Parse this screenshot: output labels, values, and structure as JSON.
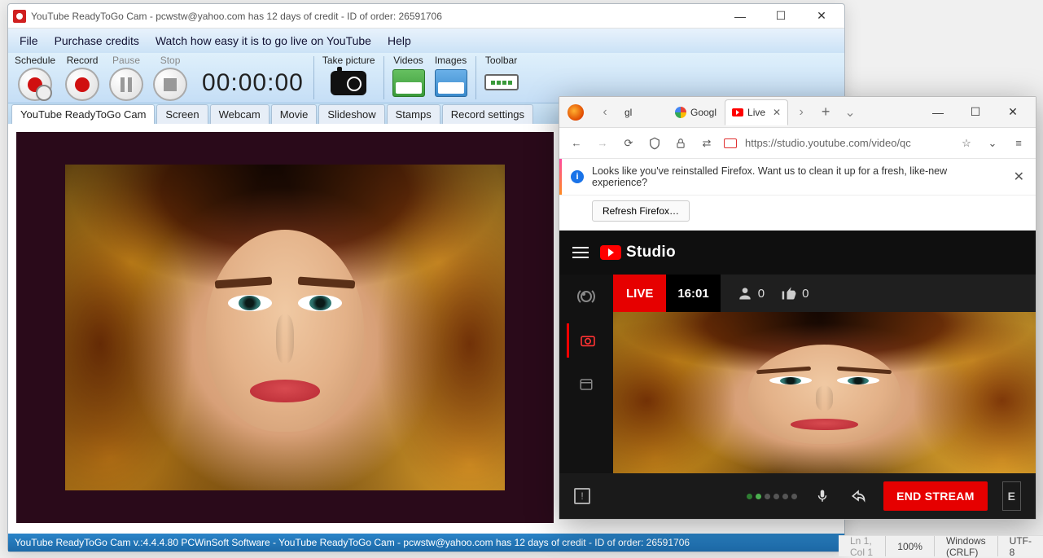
{
  "app": {
    "title": "YouTube ReadyToGo Cam - pcwstw@yahoo.com has 12 days of credit - ID of order: 26591706",
    "menu": [
      "File",
      "Purchase credits",
      "Watch how easy it is to go live on YouTube",
      "Help"
    ],
    "toolbar": {
      "schedule": "Schedule",
      "record": "Record",
      "pause": "Pause",
      "stop": "Stop",
      "timer": "00:00:00",
      "take_picture": "Take picture",
      "videos": "Videos",
      "images": "Images",
      "toolbar_label": "Toolbar"
    },
    "tabs": [
      "YouTube ReadyToGo Cam",
      "Screen",
      "Webcam",
      "Movie",
      "Slideshow",
      "Stamps",
      "Record settings"
    ],
    "active_tab_index": 0,
    "status": "YouTube ReadyToGo Cam v.:4.4.4.80 PCWinSoft Software - YouTube ReadyToGo Cam - pcwstw@yahoo.com has 12 days of credit - ID of order: 26591706"
  },
  "browser": {
    "tabs": [
      {
        "label": "gl"
      },
      {
        "label": "Googl"
      },
      {
        "label": "Live",
        "active": true
      }
    ],
    "url": "https://studio.youtube.com/video/qc",
    "info_text": "Looks like you've reinstalled Firefox. Want us to clean it up for a fresh, like-new experience?",
    "refresh_label": "Refresh Firefox…"
  },
  "studio": {
    "brand": "Studio",
    "live_badge": "LIVE",
    "elapsed": "16:01",
    "viewers": "0",
    "likes": "0",
    "end_label": "END STREAM",
    "edge_label": "E"
  },
  "editor_status": {
    "cut": "Ln 1, Col 1",
    "zoom": "100%",
    "eol": "Windows (CRLF)",
    "enc": "UTF-8"
  }
}
